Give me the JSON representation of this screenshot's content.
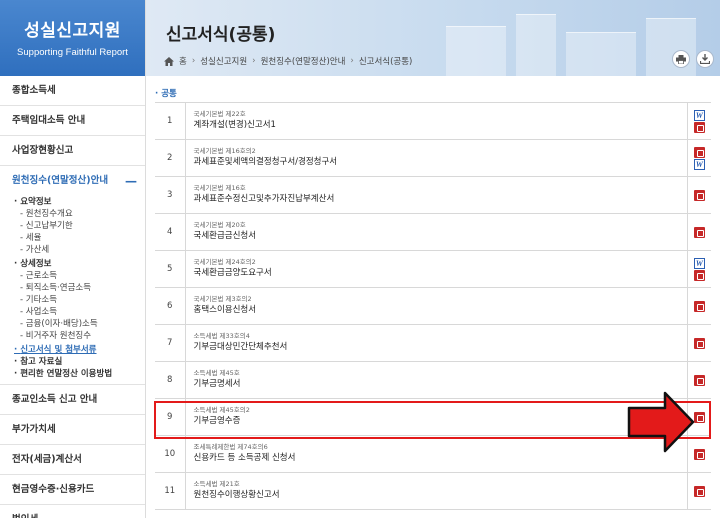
{
  "brand": {
    "title": "성실신고지원",
    "subtitle": "Supporting Faithful Report"
  },
  "sidebar": {
    "top_items": [
      "종합소득세",
      "주택임대소득 안내",
      "사업장현황신고"
    ],
    "active": {
      "label": "원천징수(연말정산)안내",
      "collapse": "—"
    },
    "sub": {
      "g1": "요약정보",
      "g1_items": [
        "원천징수개요",
        "신고납부기한",
        "세율",
        "가산세"
      ],
      "g2": "상세정보",
      "g2_items": [
        "근로소득",
        "퇴직소득·연금소득",
        "기타소득",
        "사업소득",
        "금융(이자·배당)소득",
        "비거주자 원천징수"
      ],
      "g3": "신고서식 및 첨부서류",
      "g4": "참고 자료실",
      "g5": "편리한 연말정산 이용방법"
    },
    "bottom_items": [
      "종교인소득 신고 안내",
      "부가가치세",
      "전자(세금)계산서",
      "현금영수증·신용카드",
      "법인세"
    ]
  },
  "header": {
    "title": "신고서식(공통)",
    "breadcrumb": [
      "홈",
      "성실신고지원",
      "원천징수(연말정산)안내",
      "신고서식(공통)"
    ]
  },
  "section_label": "· 공통",
  "forms": [
    {
      "num": "1",
      "law": "국세기본법 제22호",
      "name": "계좌개설(변경)신고서1",
      "files": [
        "word",
        "pdf"
      ]
    },
    {
      "num": "2",
      "law": "국세기본법 제16호의2",
      "name": "과세표준및세액의결정청구서/경정청구서",
      "files": [
        "pdf",
        "word"
      ]
    },
    {
      "num": "3",
      "law": "국세기본법 제16호",
      "name": "과세표준수정신고및추가자진납부계산서",
      "files": [
        "pdf"
      ]
    },
    {
      "num": "4",
      "law": "국세기본법 제20호",
      "name": "국세환급금신청서",
      "files": [
        "pdf"
      ]
    },
    {
      "num": "5",
      "law": "국세기본법 제24호의2",
      "name": "국세환급금양도요구서",
      "files": [
        "word",
        "pdf"
      ]
    },
    {
      "num": "6",
      "law": "국세기본법 제3호의2",
      "name": "홈택스이용신청서",
      "files": [
        "pdf"
      ]
    },
    {
      "num": "7",
      "law": "소득세법 제33호의4",
      "name": "기부금대상민간단체추천서",
      "files": [
        "pdf"
      ]
    },
    {
      "num": "8",
      "law": "소득세법 제45호",
      "name": "기부금명세서",
      "files": [
        "pdf"
      ]
    },
    {
      "num": "9",
      "law": "소득세법 제45호의2",
      "name": "기부금영수증",
      "files": [
        "pdf"
      ]
    },
    {
      "num": "10",
      "law": "조세특례제한법 제74호의6",
      "name": "신용카드 등 소득공제 신청서",
      "files": [
        "pdf"
      ]
    },
    {
      "num": "11",
      "law": "소득세법 제21호",
      "name": "원천징수이행상황신고서",
      "files": [
        "pdf"
      ]
    }
  ],
  "colors": {
    "brand": "#2f6fbe",
    "accent": "#2e6cb5",
    "highlight": "#e31a1a"
  }
}
